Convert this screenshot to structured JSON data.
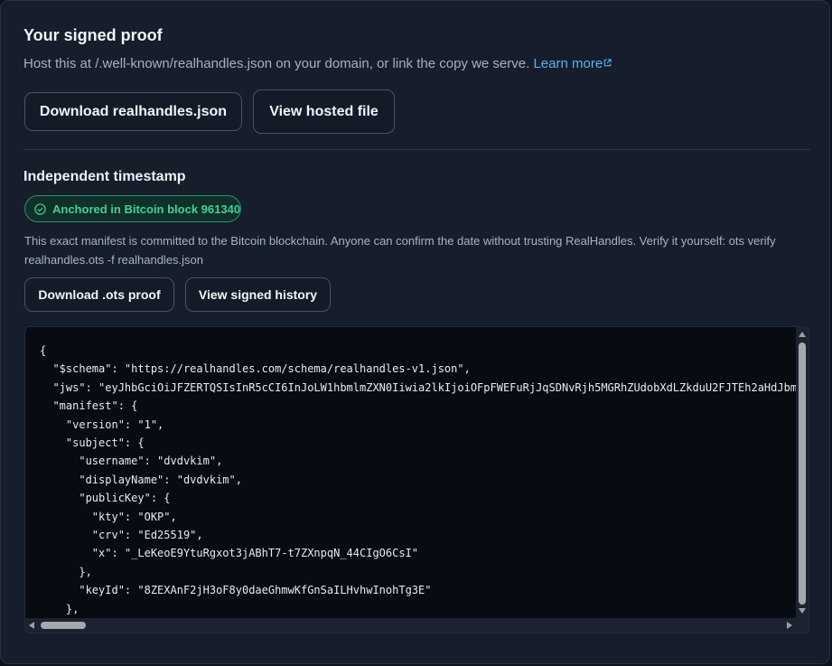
{
  "proof": {
    "title": "Your signed proof",
    "subtitle": "Host this at /.well-known/realhandles.json on your domain, or link the copy we serve.",
    "learn_more": "Learn more",
    "download_json": "Download realhandles.json",
    "view_hosted": "View hosted file"
  },
  "timestamp": {
    "title": "Independent timestamp",
    "badge": "Anchored in Bitcoin block 961340",
    "description": "This exact manifest is committed to the Bitcoin blockchain. Anyone can confirm the date without trusting RealHandles. Verify it yourself: ots verify realhandles.ots -f realhandles.json",
    "download_ots": "Download .ots proof",
    "view_history": "View signed history"
  },
  "code": {
    "text": "{\n  \"$schema\": \"https://realhandles.com/schema/realhandles-v1.json\",\n  \"jws\": \"eyJhbGciOiJFZERTQSIsInR5cCI6InJoLW1hbmlmZXN0Iiwia2lkIjoiOFpFWEFuRjJqSDNvRjh5MGRhZUdobXdLZkduU2FJTEh2aHdJbm\n  \"manifest\": {\n    \"version\": \"1\",\n    \"subject\": {\n      \"username\": \"dvdvkim\",\n      \"displayName\": \"dvdvkim\",\n      \"publicKey\": {\n        \"kty\": \"OKP\",\n        \"crv\": \"Ed25519\",\n        \"x\": \"_LeKeoE9YtuRgxot3jABhT7-t7ZXnpqN_44CIgO6CsI\"\n      },\n      \"keyId\": \"8ZEXAnF2jH3oF8y0daeGhmwKfGnSaILHvhwInohTg3E\"\n    },"
  },
  "colors": {
    "link": "#5cb3f0",
    "badge_text": "#45cf98",
    "badge_border": "#2e8f6e",
    "card_bg": "#161d2b",
    "code_bg": "#080b11"
  },
  "icons": {
    "external_link": "external-link-icon",
    "check": "check-circle-icon"
  }
}
